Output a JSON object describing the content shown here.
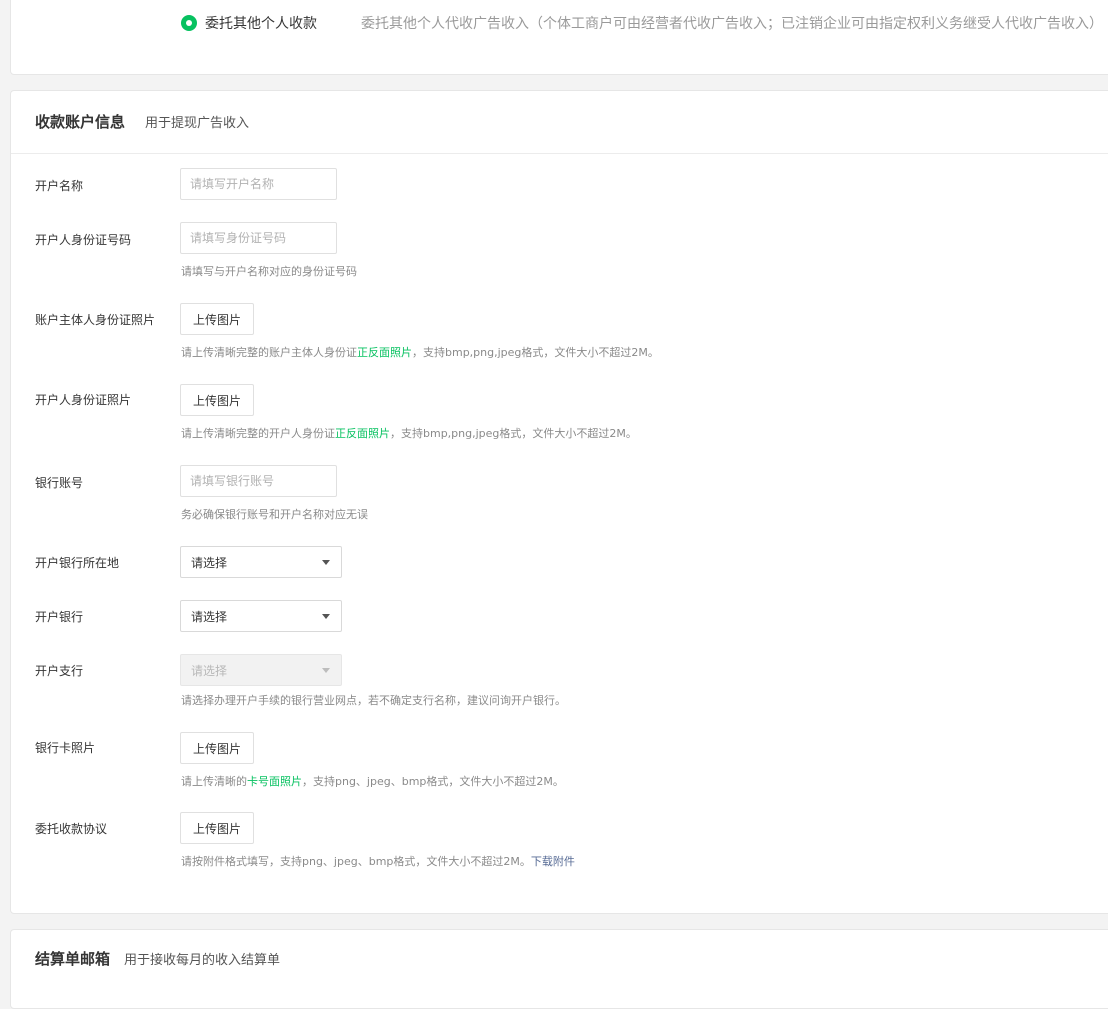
{
  "top": {
    "radio_label": "委托其他个人收款",
    "radio_desc": "委托其他个人代收广告收入（个体工商户可由经营者代收广告收入；已注销企业可由指定权利义务继受人代收广告收入）"
  },
  "section": {
    "title": "收款账户信息",
    "subtitle": "用于提现广告收入"
  },
  "fields": {
    "name": {
      "label": "开户名称",
      "placeholder": "请填写开户名称"
    },
    "id_number": {
      "label": "开户人身份证号码",
      "placeholder": "请填写身份证号码",
      "hint": "请填写与开户名称对应的身份证号码"
    },
    "subject_photo": {
      "label": "账户主体人身份证照片",
      "button": "上传图片",
      "hint_pre": "请上传清晰完整的账户主体人身份证",
      "hint_em": "正反面照片",
      "hint_post": "，支持bmp,png,jpeg格式，文件大小不超过2M。"
    },
    "holder_photo": {
      "label": "开户人身份证照片",
      "button": "上传图片",
      "hint_pre": "请上传清晰完整的开户人身份证",
      "hint_em": "正反面照片",
      "hint_post": "，支持bmp,png,jpeg格式，文件大小不超过2M。"
    },
    "account_number": {
      "label": "银行账号",
      "placeholder": "请填写银行账号",
      "hint": "务必确保银行账号和开户名称对应无误"
    },
    "bank_location": {
      "label": "开户银行所在地",
      "value": "请选择"
    },
    "bank": {
      "label": "开户银行",
      "value": "请选择"
    },
    "branch": {
      "label": "开户支行",
      "value": "请选择",
      "hint": "请选择办理开户手续的银行营业网点，若不确定支行名称，建议问询开户银行。"
    },
    "card_photo": {
      "label": "银行卡照片",
      "button": "上传图片",
      "hint_pre": "请上传清晰的",
      "hint_em": "卡号面照片",
      "hint_post": "，支持png、jpeg、bmp格式，文件大小不超过2M。"
    },
    "agreement": {
      "label": "委托收款协议",
      "button": "上传图片",
      "hint_pre": "请按附件格式填写，支持png、jpeg、bmp格式，文件大小不超过2M。",
      "hint_link": "下载附件"
    }
  },
  "bottom": {
    "title": "结算单邮箱",
    "subtitle": "用于接收每月的收入结算单"
  },
  "colors": {
    "accent_green": "#07c160",
    "link_blue": "#576b95"
  }
}
